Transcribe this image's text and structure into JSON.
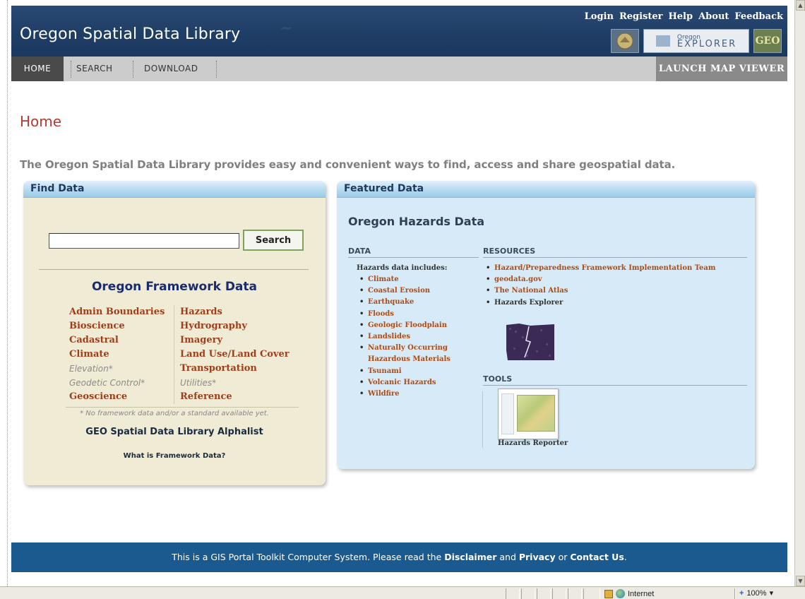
{
  "header": {
    "site_title": "Oregon Spatial Data Library",
    "links": [
      "Login",
      "Register",
      "Help",
      "About",
      "Feedback"
    ],
    "explorer_top": "Oregon",
    "explorer_bottom": "EXPLORER",
    "geo_logo": "GEO"
  },
  "nav": {
    "home": "HOME",
    "search": "SEARCH",
    "download": "DOWNLOAD",
    "launch": "LAUNCH MAP VIEWER"
  },
  "page": {
    "title": "Home",
    "intro": "The Oregon Spatial Data Library provides easy and convenient ways to find, access and share geospatial data."
  },
  "find": {
    "heading": "Find Data",
    "search_value": "",
    "search_button": "Search",
    "framework_heading": "Oregon Framework Data",
    "col1": [
      {
        "label": "Admin Boundaries",
        "dim": false
      },
      {
        "label": "Bioscience",
        "dim": false
      },
      {
        "label": "Cadastral",
        "dim": false
      },
      {
        "label": "Climate",
        "dim": false
      },
      {
        "label": "Elevation*",
        "dim": true
      },
      {
        "label": "Geodetic Control*",
        "dim": true
      },
      {
        "label": "Geoscience",
        "dim": false
      }
    ],
    "col2": [
      {
        "label": "Hazards",
        "dim": false
      },
      {
        "label": "Hydrography",
        "dim": false
      },
      {
        "label": "Imagery",
        "dim": false
      },
      {
        "label": "Land Use/Land Cover",
        "dim": false
      },
      {
        "label": "Transportation",
        "dim": false
      },
      {
        "label": "Utilities*",
        "dim": true
      },
      {
        "label": "Reference",
        "dim": false
      }
    ],
    "note": "* No framework data and/or a standard available yet.",
    "alphalist": "GEO Spatial Data Library Alphalist",
    "what_is": "What is Framework Data?"
  },
  "featured": {
    "heading": "Featured Data",
    "title": "Oregon Hazards Data",
    "data_heading": "DATA",
    "data_intro": "Hazards data includes:",
    "data_items": [
      "Climate",
      "Coastal Erosion",
      "Earthquake",
      "Floods",
      "Geologic Floodplain",
      "Landslides",
      "Naturally Occurring Hazardous Materials",
      "Tsunami",
      "Volcanic Hazards",
      "Wildfire"
    ],
    "resources_heading": "RESOURCES",
    "resource_items": [
      {
        "label": "Hazard/Preparedness Framework Implementation Team",
        "plain": false
      },
      {
        "label": "geodata.gov",
        "plain": false
      },
      {
        "label": "The National Atlas",
        "plain": false
      },
      {
        "label": "Hazards Explorer",
        "plain": true
      }
    ],
    "tools_heading": "TOOLS",
    "tool_label": "Hazards Reporter"
  },
  "footer": {
    "text_pre": "This is a GIS Portal Toolkit Computer System. Please read the ",
    "disclaimer": "Disclaimer",
    "and": " and ",
    "privacy": "Privacy",
    "or": " or ",
    "contact": "Contact Us",
    "end": "."
  },
  "statusbar": {
    "zone": "Internet",
    "zoom": "100%"
  },
  "colors": {
    "header_bg": "#1f3e66",
    "title_red": "#b13b32",
    "link_rust": "#9e3e1a",
    "footer_bg": "#1b5a8e"
  }
}
